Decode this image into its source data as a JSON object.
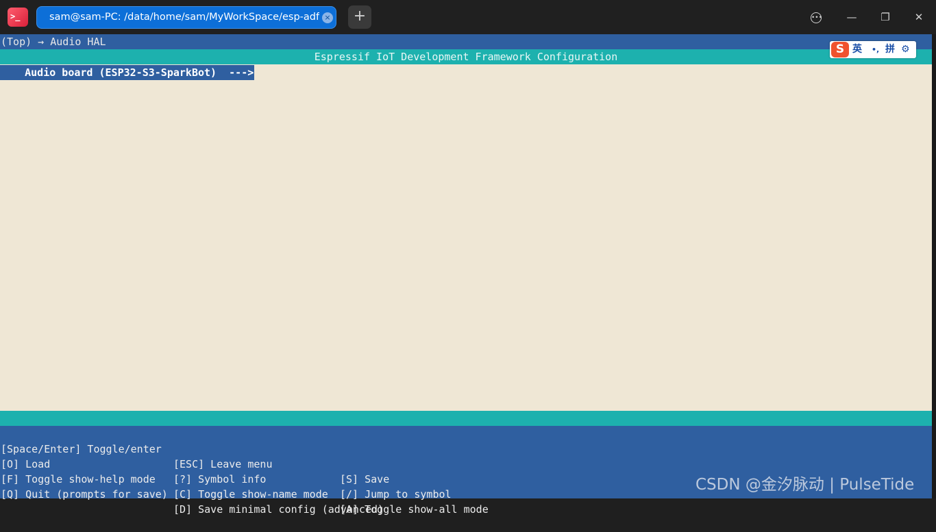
{
  "window": {
    "tab_title": "sam@sam-PC: /data/home/sam/MyWorkSpace/esp-adf/exa···",
    "tab_close_glyph": "×",
    "new_tab_glyph": "+",
    "app_icon_glyph": ">_",
    "more_glyph": "•••",
    "minimize_glyph": "—",
    "maximize_glyph": "❐",
    "close_glyph": "✕"
  },
  "terminal": {
    "breadcrumb": "(Top) → Audio HAL",
    "header": "Espressif IoT Development Framework Configuration",
    "menu_items": [
      {
        "label": "    Audio board (ESP32-S3-SparkBot)  --->",
        "selected": true
      }
    ],
    "help_rows": [
      [
        "[Space/Enter] Toggle/enter",
        "[ESC] Leave menu",
        "[S] Save"
      ],
      [
        "[O] Load",
        "[?] Symbol info",
        "[/] Jump to symbol"
      ],
      [
        "[F] Toggle show-help mode",
        "[C] Toggle show-name mode",
        "[A] Toggle show-all mode"
      ],
      [
        "[Q] Quit (prompts for save)",
        "[D] Save minimal config (advanced)",
        ""
      ]
    ]
  },
  "ime": {
    "logo": "S",
    "lang": "英",
    "punct": "•,",
    "mode": "拼",
    "settings_icon": "gear-icon",
    "settings_glyph": "⚙"
  },
  "watermark": "CSDN @金汐脉动 | PulseTide",
  "colors": {
    "titlebar": "#202020",
    "tab_active": "#0d6fd8",
    "terminal_blue": "#2f5fa0",
    "header_teal": "#1db1ae",
    "menu_background": "#efe7d5"
  }
}
